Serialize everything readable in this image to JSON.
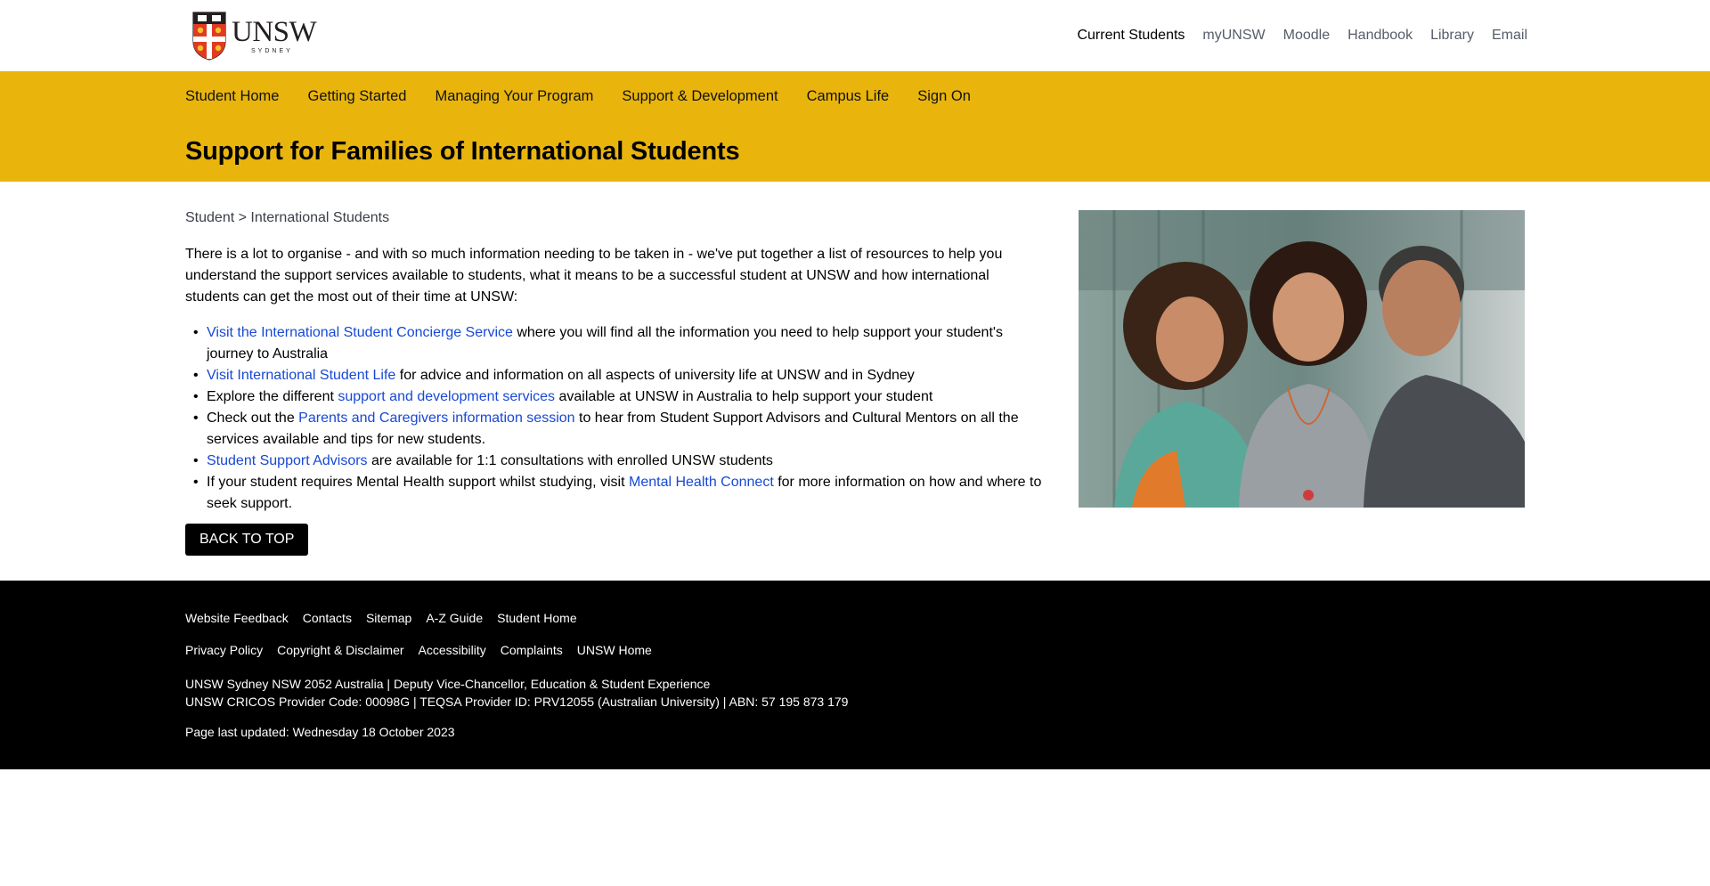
{
  "brand": {
    "logo_word": "UNSW",
    "logo_sub": "SYDNEY",
    "colors": {
      "accent": "#e9b50d",
      "link": "#1848d6",
      "footer": "#000000"
    }
  },
  "utility_nav": [
    {
      "label": "Current Students",
      "active": true
    },
    {
      "label": "myUNSW"
    },
    {
      "label": "Moodle"
    },
    {
      "label": "Handbook"
    },
    {
      "label": "Library"
    },
    {
      "label": "Email"
    }
  ],
  "main_nav": [
    {
      "label": "Student Home"
    },
    {
      "label": "Getting Started"
    },
    {
      "label": "Managing Your Program"
    },
    {
      "label": "Support & Development"
    },
    {
      "label": "Campus Life"
    },
    {
      "label": "Sign On"
    }
  ],
  "page_title": "Support for Families of International Students",
  "breadcrumb": {
    "root": "Student",
    "separator": ">",
    "current": "International Students"
  },
  "intro": "There is a lot to organise - and with so much information needing to be taken in - we've put together a list of resources to help you understand the support services available to students, what it means to be a successful student at UNSW and how international students can get the most out of their time at UNSW:",
  "resources": [
    {
      "before": "",
      "link": "Visit the International Student Concierge Service",
      "after": " where you will find all the information you need to help support your student's journey to Australia"
    },
    {
      "before": "",
      "link": "Visit International Student Life",
      "after": " for advice and information on all aspects of university life at UNSW and in Sydney"
    },
    {
      "before": "Explore the different ",
      "link": "support and development services",
      "after": " available at UNSW in Australia to help support your student"
    },
    {
      "before": "Check out the ",
      "link": "Parents and Caregivers information session",
      "after": " to hear from Student Support Advisors and Cultural Mentors on all the services available and tips for new students."
    },
    {
      "before": "",
      "link": "Student Support Advisors",
      "after": " are available for 1:1 consultations with enrolled UNSW students"
    },
    {
      "before": "If your student requires Mental Health support whilst studying, visit ",
      "link": "Mental Health Connect",
      "after": " for more information on how and where to seek support."
    }
  ],
  "back_to_top": "BACK TO TOP",
  "footer": {
    "links_row1": [
      "Website Feedback",
      "Contacts",
      "Sitemap",
      "A-Z Guide",
      "Student Home"
    ],
    "links_row2": [
      "Privacy Policy",
      "Copyright & Disclaimer",
      "Accessibility",
      "Complaints",
      "UNSW Home"
    ],
    "info_line1": "UNSW Sydney NSW 2052 Australia | Deputy Vice-Chancellor, Education & Student Experience",
    "info_line2": "UNSW CRICOS Provider Code: 00098G | TEQSA Provider ID: PRV12055 (Australian University) | ABN: 57 195 873 179",
    "updated": "Page last updated: Wednesday 18 October 2023"
  }
}
